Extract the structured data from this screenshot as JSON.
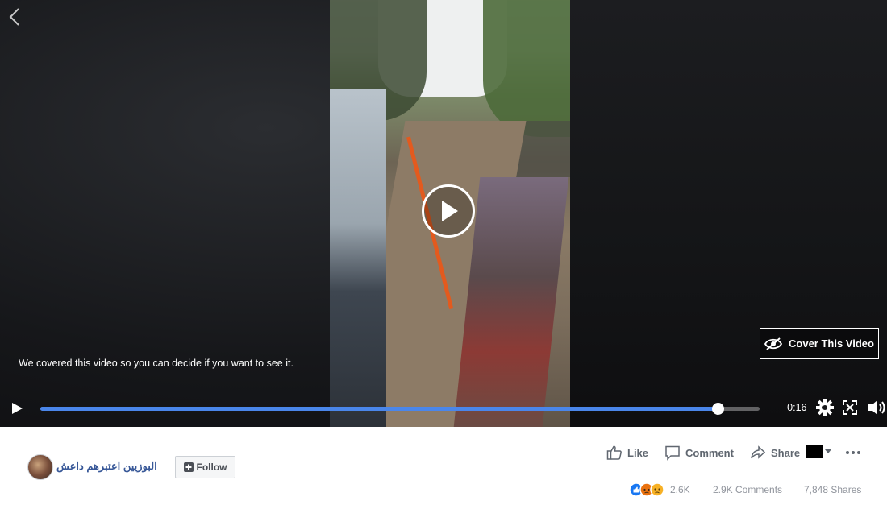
{
  "video": {
    "cover_note": "We covered this video so you can decide if you want to see it.",
    "cover_button_label": "Cover This Video",
    "time_remaining": "-0:16",
    "progress": 0.942
  },
  "page": {
    "name": "البوزيين اعتبرهم داعش",
    "follow_label": "Follow"
  },
  "actions": {
    "like_label": "Like",
    "comment_label": "Comment",
    "share_label": "Share"
  },
  "stats": {
    "reactions_count": "2.6K",
    "comments": "2.9K Comments",
    "shares": "7,848 Shares"
  },
  "colors": {
    "progress": "#4a86ea",
    "link": "#385898",
    "like_reaction": "#1877f2",
    "angry_reaction": "#e9710f",
    "sad_reaction": "#f7b125"
  },
  "icons": {
    "back": "chevron-left-icon",
    "play": "play-icon",
    "cover": "eye-slash-icon",
    "settings": "gear-icon",
    "fullscreen": "expand-icon",
    "volume": "volume-icon",
    "like": "thumbs-up-icon",
    "comment": "comment-bubble-icon",
    "share": "share-arrow-icon",
    "more": "more-horizontal-icon"
  }
}
